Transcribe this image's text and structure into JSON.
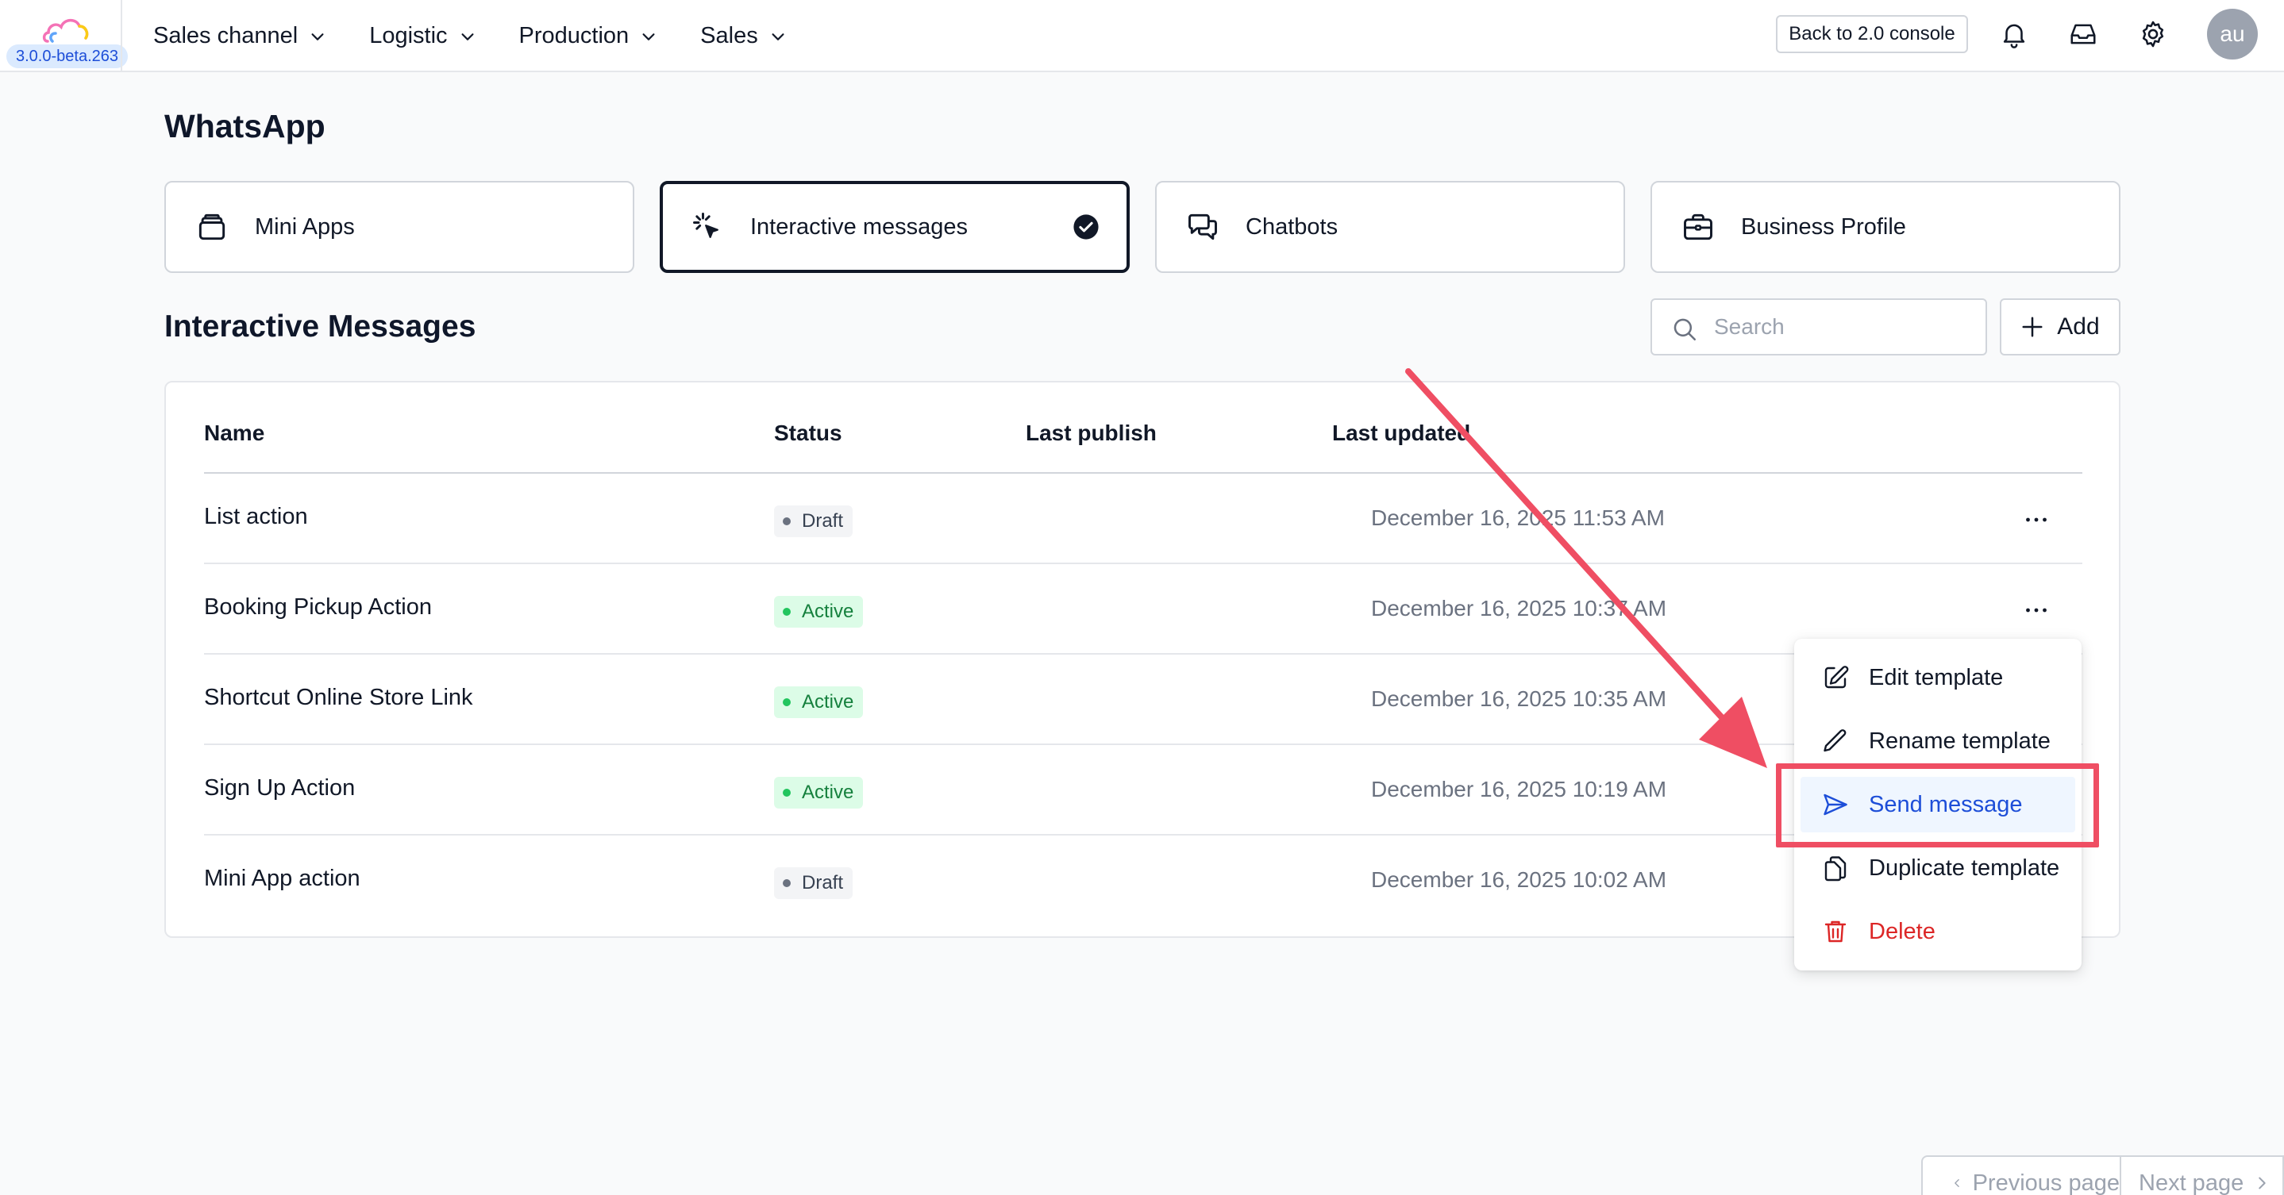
{
  "app": {
    "version": "3.0.0-beta.263",
    "nav": [
      {
        "label": "Sales channel"
      },
      {
        "label": "Logistic"
      },
      {
        "label": "Production"
      },
      {
        "label": "Sales"
      }
    ],
    "back_console_label": "Back to 2.0 console",
    "avatar_initials": "au"
  },
  "page": {
    "title": "WhatsApp",
    "cards": [
      {
        "label": "Mini Apps",
        "icon": "layers-icon",
        "selected": false
      },
      {
        "label": "Interactive messages",
        "icon": "cursor-click-icon",
        "selected": true
      },
      {
        "label": "Chatbots",
        "icon": "chat-bubbles-icon",
        "selected": false
      },
      {
        "label": "Business Profile",
        "icon": "briefcase-icon",
        "selected": false
      }
    ],
    "section_title": "Interactive Messages",
    "search_placeholder": "Search",
    "add_label": "Add"
  },
  "table": {
    "columns": [
      "Name",
      "Status",
      "Last publish",
      "Last updated"
    ],
    "rows": [
      {
        "name": "List action",
        "status": "Draft",
        "last_publish": "",
        "last_updated": "December 16, 2025 11:53 AM"
      },
      {
        "name": "Booking Pickup Action",
        "status": "Active",
        "last_publish": "",
        "last_updated": "December 16, 2025 10:37 AM"
      },
      {
        "name": "Shortcut Online Store Link",
        "status": "Active",
        "last_publish": "",
        "last_updated": "December 16, 2025 10:35 AM"
      },
      {
        "name": "Sign Up Action",
        "status": "Active",
        "last_publish": "",
        "last_updated": "December 16, 2025 10:19 AM"
      },
      {
        "name": "Mini App action",
        "status": "Draft",
        "last_publish": "",
        "last_updated": "December 16, 2025 10:02 AM"
      }
    ]
  },
  "row_menu": {
    "items": [
      {
        "label": "Edit template",
        "icon": "edit-icon"
      },
      {
        "label": "Rename template",
        "icon": "pencil-icon"
      },
      {
        "label": "Send message",
        "icon": "send-icon",
        "highlighted": true
      },
      {
        "label": "Duplicate template",
        "icon": "copy-icon"
      },
      {
        "label": "Delete",
        "icon": "trash-icon",
        "danger": true
      }
    ]
  },
  "pagination": {
    "prev_label": "Previous page",
    "next_label": "Next page"
  },
  "colors": {
    "annotation": "#ef4e63",
    "active_badge_bg": "#dcfce7",
    "active_badge_text": "#15803d",
    "highlight_text": "#1d4ed8",
    "danger": "#dc2626"
  }
}
